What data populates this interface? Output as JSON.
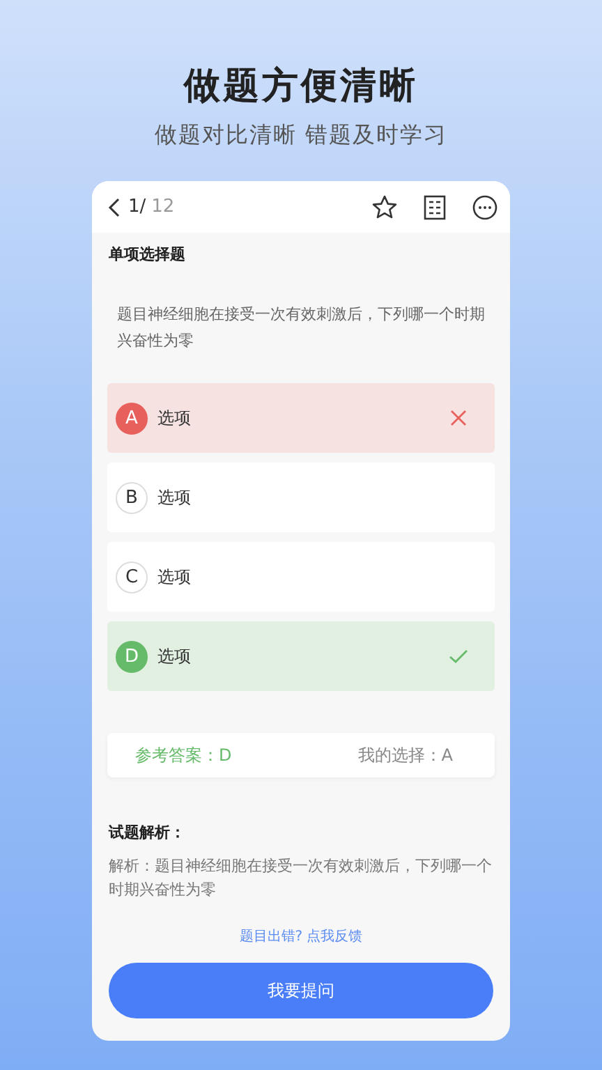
{
  "headline": "做题方便清晰",
  "subtitle": "做题对比清晰 错题及时学习",
  "header": {
    "current": "1/",
    "total": "12"
  },
  "question_type": "单项选择题",
  "question": "题目神经细胞在接受一次有效刺激后，下列哪一个时期兴奋性为零",
  "options": [
    {
      "letter": "A",
      "text": "选项",
      "kind": "wrong"
    },
    {
      "letter": "B",
      "text": "选项",
      "kind": "plain"
    },
    {
      "letter": "C",
      "text": "选项",
      "kind": "plain"
    },
    {
      "letter": "D",
      "text": "选项",
      "kind": "correct"
    }
  ],
  "answer": {
    "reference": "参考答案：D",
    "mine": "我的选择：A"
  },
  "analysis": {
    "title": "试题解析：",
    "text": "解析：题目神经细胞在接受一次有效刺激后，下列哪一个时期兴奋性为零"
  },
  "feedback_link": "题目出错? 点我反馈",
  "ask_button": "我要提问"
}
